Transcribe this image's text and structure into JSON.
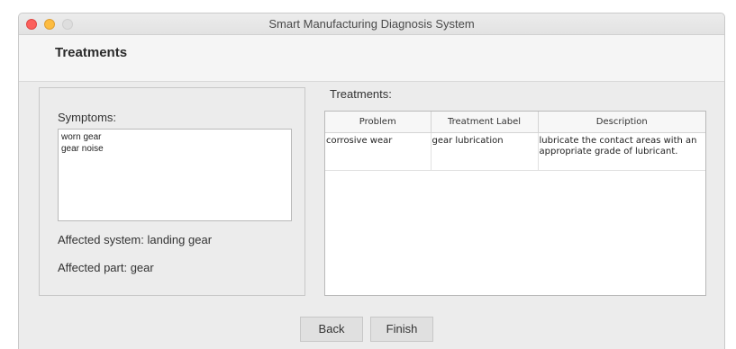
{
  "window": {
    "title": "Smart Manufacturing Diagnosis System"
  },
  "header": {
    "title": "Treatments"
  },
  "symptoms": {
    "label": "Symptoms:",
    "items": [
      "worn gear",
      "gear noise"
    ]
  },
  "affected": {
    "system": "Affected system: landing gear",
    "part": "Affected part: gear"
  },
  "treatments": {
    "label": "Treatments:",
    "columns": [
      "Problem",
      "Treatment Label",
      "Description"
    ],
    "rows": [
      [
        "corrosive wear",
        "gear lubrication",
        "lubricate the contact areas with an appropriate grade of lubricant."
      ]
    ]
  },
  "buttons": {
    "back": "Back",
    "finish": "Finish"
  },
  "colors": {
    "close": "#fc605c",
    "minimize": "#fdbc40",
    "maximize": "#dedede",
    "window_bg": "#ececec"
  }
}
